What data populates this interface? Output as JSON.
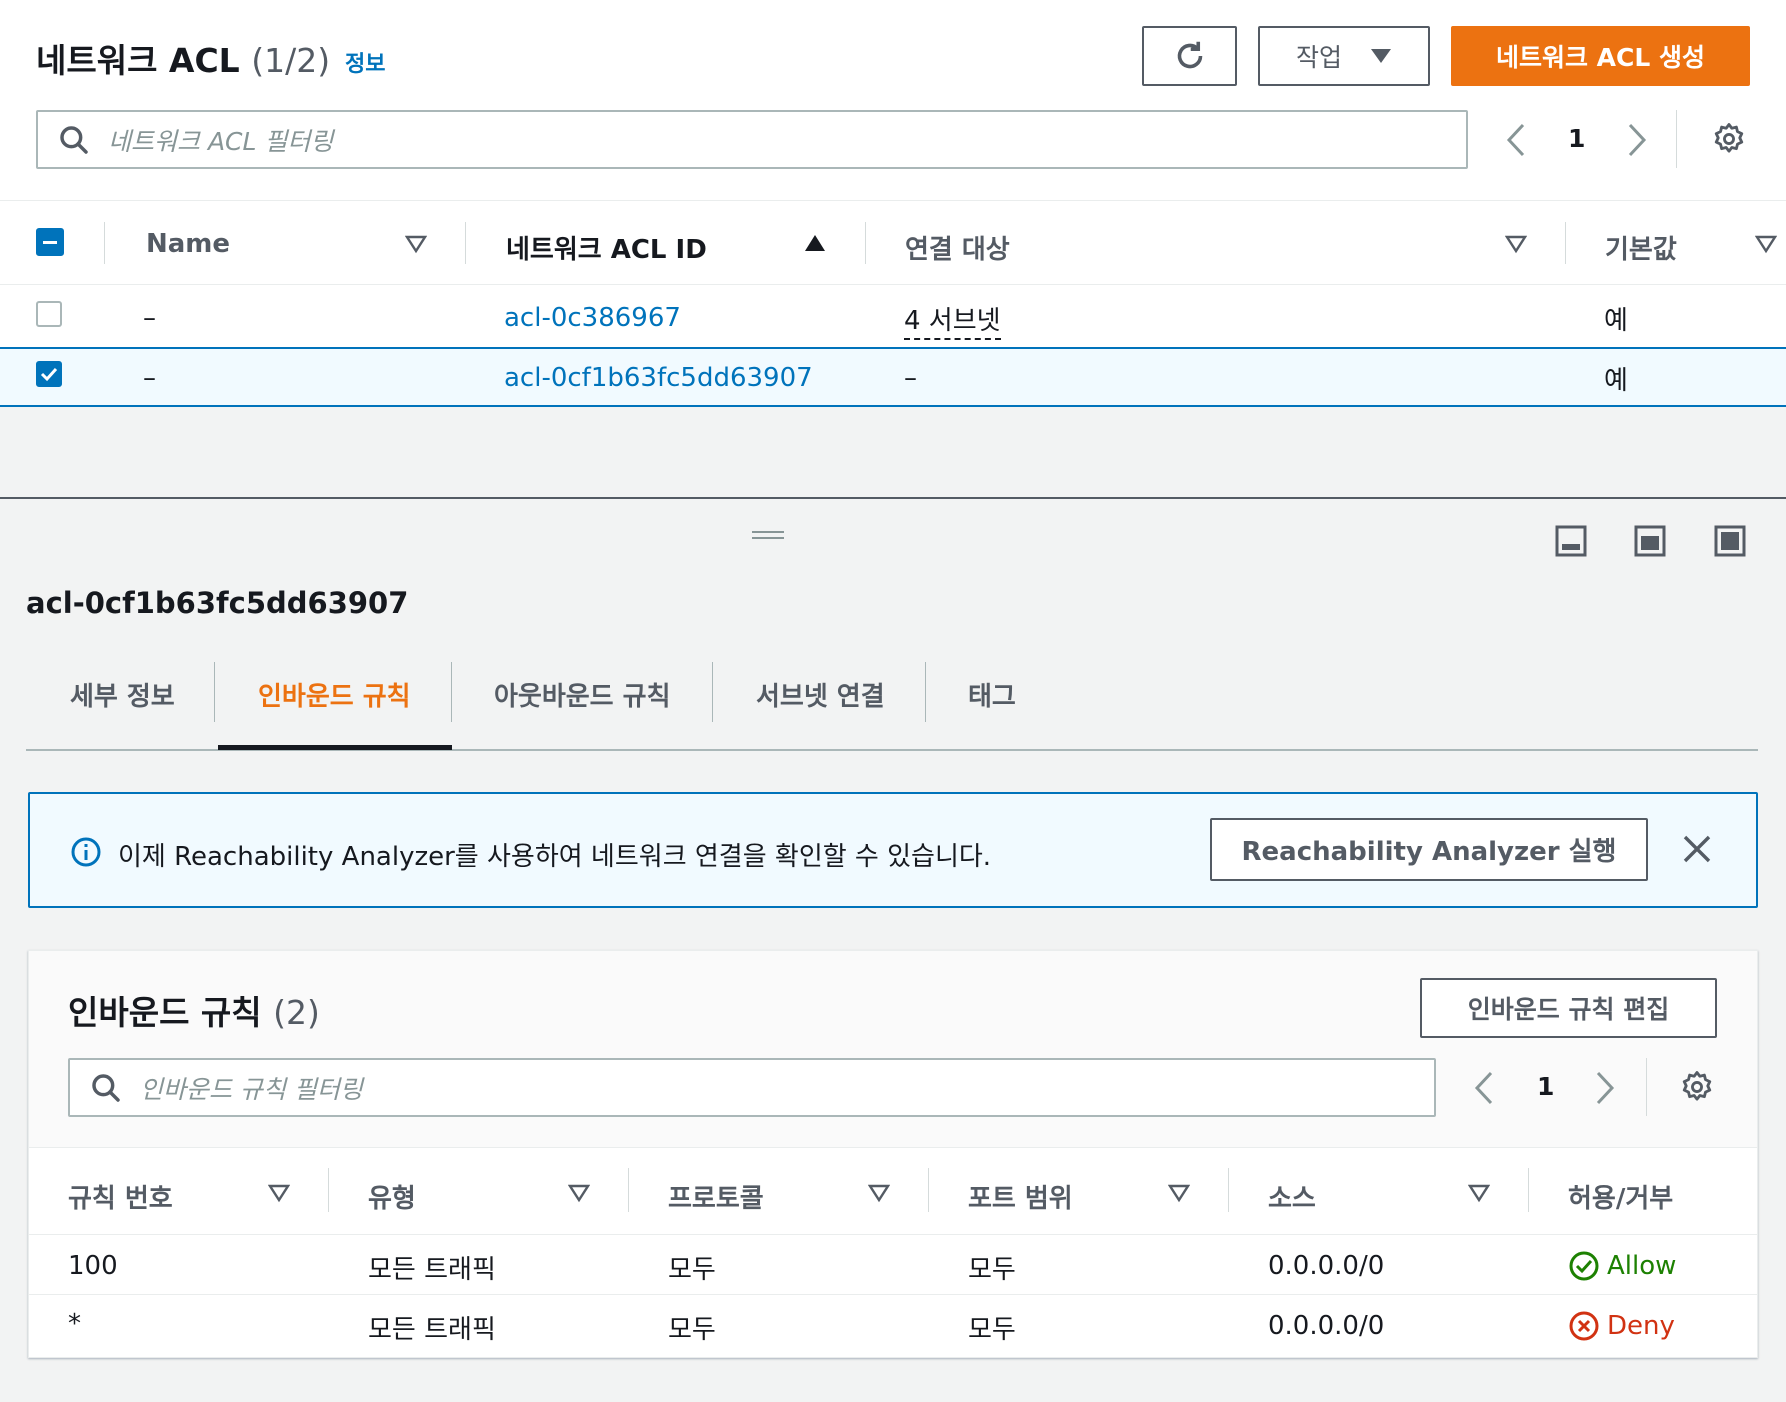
{
  "header": {
    "title": "네트워크 ACL",
    "count": "(1/2)",
    "info_link": "정보",
    "refresh_icon": "refresh-icon",
    "actions_label": "작업",
    "create_label": "네트워크 ACL 생성",
    "filter_placeholder": "네트워크 ACL 필터링",
    "page": "1"
  },
  "acl_table": {
    "columns": [
      "Name",
      "네트워크 ACL ID",
      "연결 대상",
      "기본값"
    ],
    "rows": [
      {
        "name": "–",
        "id": "acl-0c386967",
        "assoc": "4 서브넷",
        "default": "예",
        "selected": false
      },
      {
        "name": "–",
        "id": "acl-0cf1b63fc5dd63907",
        "assoc": "–",
        "default": "예",
        "selected": true
      }
    ]
  },
  "detail": {
    "title": "acl-0cf1b63fc5dd63907",
    "tabs": [
      "세부 정보",
      "인바운드 규칙",
      "아웃바운드 규칙",
      "서브넷 연결",
      "태그"
    ],
    "active_tab": 1
  },
  "banner": {
    "text": "이제 Reachability Analyzer를 사용하여 네트워크 연결을 확인할 수 있습니다.",
    "button": "Reachability Analyzer 실행"
  },
  "inbound": {
    "title": "인바운드 규칙",
    "count": "(2)",
    "edit_button": "인바운드 규칙 편집",
    "filter_placeholder": "인바운드 규칙 필터링",
    "page": "1",
    "columns": [
      "규칙 번호",
      "유형",
      "프로토콜",
      "포트 범위",
      "소스",
      "허용/거부"
    ],
    "rows": [
      {
        "rule": "100",
        "type": "모든 트래픽",
        "protocol": "모두",
        "ports": "모두",
        "source": "0.0.0.0/0",
        "action": "Allow"
      },
      {
        "rule": "*",
        "type": "모든 트래픽",
        "protocol": "모두",
        "ports": "모두",
        "source": "0.0.0.0/0",
        "action": "Deny"
      }
    ]
  },
  "colors": {
    "accent": "#ec7211",
    "link": "#0073bb",
    "allow": "#1d8102",
    "deny": "#d13212"
  }
}
